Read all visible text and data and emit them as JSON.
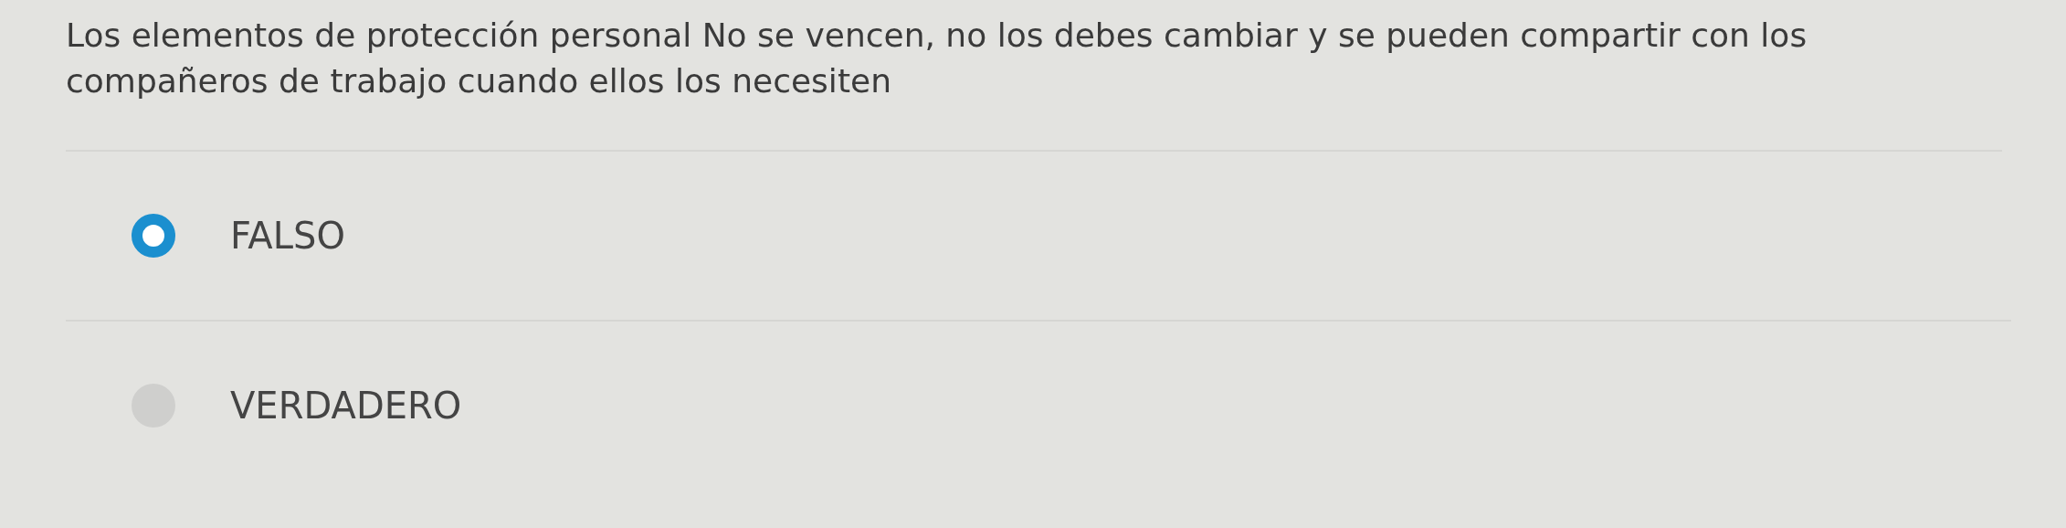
{
  "question": "Los elementos de protección personal No se vencen, no los debes cambiar y se pueden compartir con los compañeros de trabajo cuando ellos los necesiten",
  "options": [
    {
      "label": "FALSO",
      "selected": true
    },
    {
      "label": "VERDADERO",
      "selected": false
    }
  ]
}
